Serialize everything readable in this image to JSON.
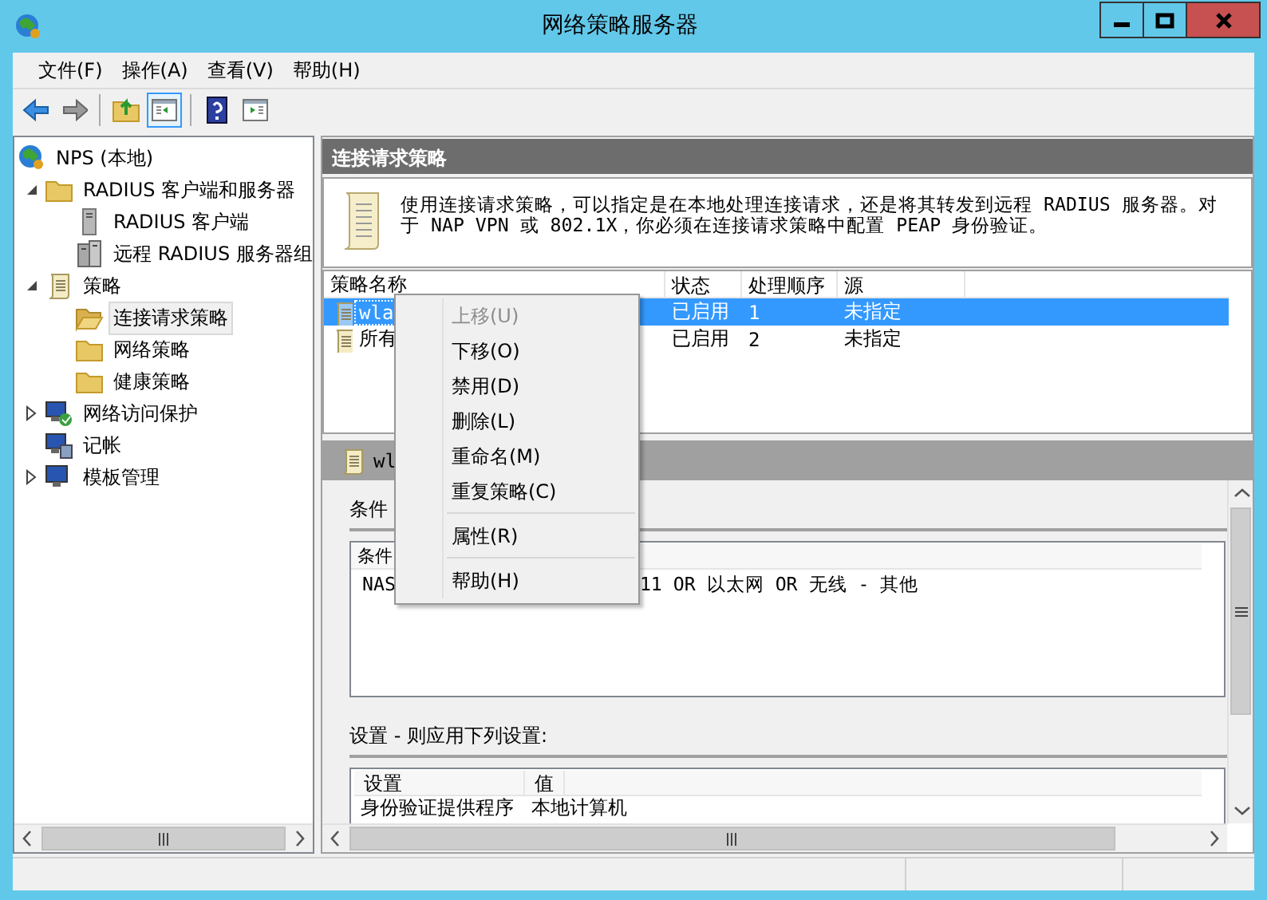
{
  "window": {
    "title": "网络策略服务器"
  },
  "menu_bar": [
    "文件(F)",
    "操作(A)",
    "查看(V)",
    "帮助(H)"
  ],
  "toolbar": [
    {
      "kind": "back",
      "disabled": false,
      "pressed": false
    },
    {
      "kind": "forward",
      "disabled": true,
      "pressed": false
    },
    {
      "kind": "up",
      "disabled": false,
      "pressed": false
    },
    {
      "kind": "tree-toggle",
      "disabled": false,
      "pressed": true
    },
    {
      "kind": "help",
      "disabled": false,
      "pressed": false
    },
    {
      "kind": "action-pane",
      "disabled": false,
      "pressed": false
    }
  ],
  "tree": [
    {
      "label": "NPS (本地)",
      "kind": "root",
      "selected": false,
      "children": [
        {
          "label": "RADIUS 客户端和服务器",
          "kind": "folder",
          "selected": false,
          "expanded": true,
          "children": [
            {
              "label": "RADIUS 客户端",
              "kind": "server",
              "selected": false
            },
            {
              "label": "远程 RADIUS 服务器组",
              "kind": "server-group",
              "selected": false
            }
          ]
        },
        {
          "label": "策略",
          "kind": "policy",
          "selected": false,
          "expanded": true,
          "children": [
            {
              "label": "连接请求策略",
              "kind": "open-folder",
              "selected": true
            },
            {
              "label": "网络策略",
              "kind": "folder",
              "selected": false
            },
            {
              "label": "健康策略",
              "kind": "folder",
              "selected": false
            }
          ]
        },
        {
          "label": "网络访问保护",
          "kind": "network",
          "selected": false,
          "expanded": false
        },
        {
          "label": "记帐",
          "kind": "accounting",
          "selected": false
        },
        {
          "label": "模板管理",
          "kind": "template",
          "selected": false,
          "expanded": false
        }
      ]
    }
  ],
  "pane": {
    "title": "连接请求策略",
    "description": "使用连接请求策略，可以指定是在本地处理连接请求，还是将其转发到远程 RADIUS 服务器。对于 NAP VPN 或 802.1X，你必须在连接请求策略中配置 PEAP 身份验证。",
    "table": {
      "columns": [
        "策略名称",
        "状态",
        "处理顺序",
        "源"
      ],
      "rows": [
        {
          "name": "wla",
          "status": "已启用",
          "order": "1",
          "source": "未指定",
          "selected": true
        },
        {
          "name": "所有",
          "status": "已启用",
          "order": "2",
          "source": "未指定",
          "selected": false
        }
      ]
    },
    "details": {
      "title": "wl",
      "conditions_label": "条件",
      "conditions": {
        "column_1": "条件",
        "rows": [
          {
            "column_1": "NAS",
            "column_2": "11 OR 以太网 OR 无线 - 其他"
          }
        ]
      },
      "settings_label": "设置 - 则应用下列设置:",
      "settings": {
        "columns": [
          "设置",
          "值"
        ],
        "rows": [
          {
            "setting": "身份验证提供程序",
            "value": "本地计算机"
          }
        ]
      }
    }
  },
  "context_menu": [
    {
      "kind": "item",
      "label": "上移(U)",
      "disabled": true
    },
    {
      "kind": "item",
      "label": "下移(O)",
      "disabled": false
    },
    {
      "kind": "item",
      "label": "禁用(D)",
      "disabled": false
    },
    {
      "kind": "item",
      "label": "删除(L)",
      "disabled": false
    },
    {
      "kind": "item",
      "label": "重命名(M)",
      "disabled": false
    },
    {
      "kind": "item",
      "label": "重复策略(C)",
      "disabled": false
    },
    {
      "kind": "separator"
    },
    {
      "kind": "item",
      "label": "属性(R)",
      "disabled": false
    },
    {
      "kind": "separator"
    },
    {
      "kind": "item",
      "label": "帮助(H)",
      "disabled": false
    }
  ]
}
